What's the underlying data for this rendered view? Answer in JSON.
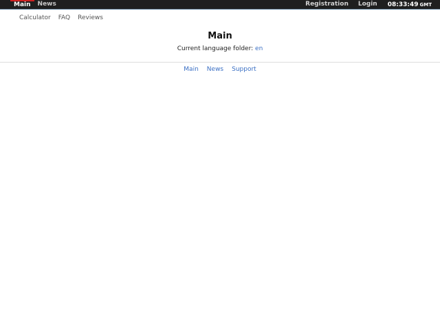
{
  "topbar": {
    "left": [
      {
        "label": "Main",
        "active": true
      },
      {
        "label": "News",
        "active": false
      }
    ],
    "right": [
      {
        "label": "Registration"
      },
      {
        "label": "Login"
      }
    ],
    "time": "08:33:49",
    "timezone": "GMT"
  },
  "subnav": {
    "items": [
      {
        "label": "Calculator"
      },
      {
        "label": "FAQ"
      },
      {
        "label": "Reviews"
      }
    ]
  },
  "main": {
    "title": "Main",
    "language_prefix": "Current language folder:",
    "language_value": "en"
  },
  "footer": {
    "links": [
      {
        "label": "Main"
      },
      {
        "label": "News"
      },
      {
        "label": "Support"
      }
    ]
  },
  "colors": {
    "topbar_bg": "#1f1f1f",
    "active_accent": "#cc2222",
    "link": "#3a6fc4"
  }
}
